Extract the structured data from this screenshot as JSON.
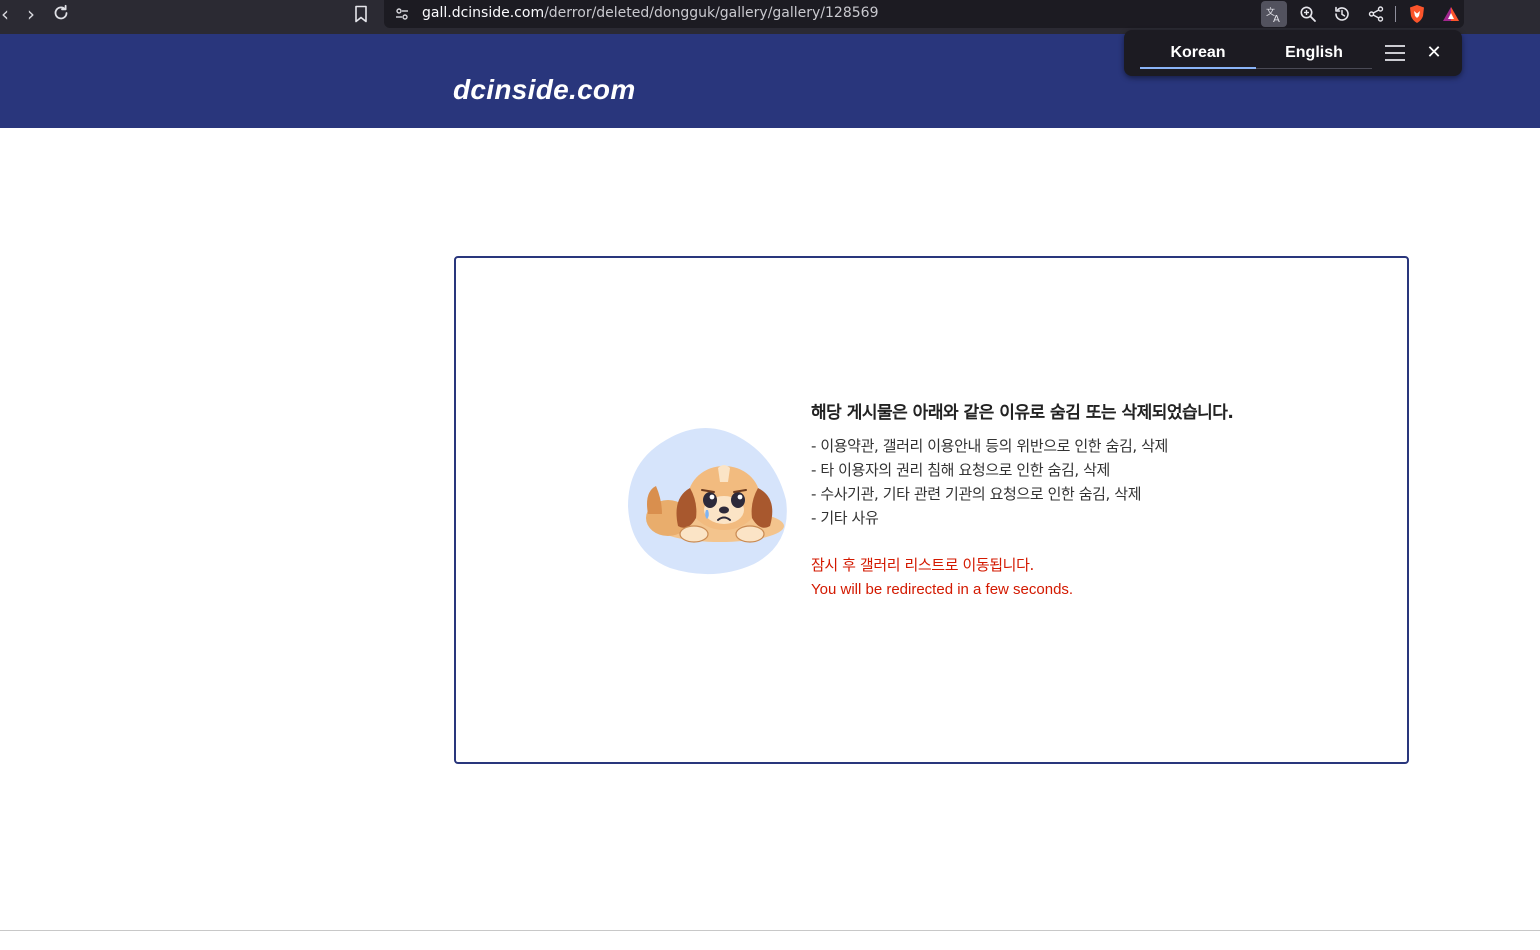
{
  "browser": {
    "url_host": "gall.dcinside.com",
    "url_path": "/derror/deleted/dongguk/gallery/gallery/128569",
    "back_icon": "chevron-left-icon",
    "forward_icon": "chevron-right-icon",
    "reload_icon": "reload-icon",
    "bookmark_icon": "bookmark-icon",
    "actions": [
      "translate-icon",
      "zoom-icon",
      "history-icon",
      "share-icon",
      "brave-shield-icon",
      "brave-rewards-icon"
    ]
  },
  "translate_popup": {
    "source_lang": "Korean",
    "target_lang": "English",
    "accent_color": "#8ab4f8",
    "close_symbol": "✕"
  },
  "site": {
    "logo_text": "dcinside.com",
    "header_color": "#29367c"
  },
  "notice": {
    "title": "해당 게시물은 아래와 같은 이유로 숨김 또는 삭제되었습니다.",
    "reasons": [
      "- 이용약관, 갤러리 이용안내 등의 위반으로 인한 숨김, 삭제",
      "- 타 이용자의 권리 침해 요청으로 인한 숨김, 삭제",
      "- 수사기관, 기타 관련 기관의 요청으로 인한 숨김, 삭제",
      "- 기타 사유"
    ],
    "redirect_ko": "잠시 후 갤러리 리스트로 이동됩니다.",
    "redirect_en": "You will be redirected in a few seconds.",
    "redirect_color": "#d31900",
    "illustration": "sad-puppy-illustration"
  }
}
